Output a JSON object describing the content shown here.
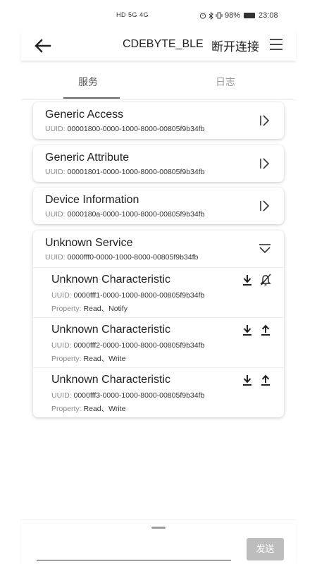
{
  "status_bar": {
    "signal_text": "HD 5G 4G",
    "alarm_icon": "alarm-icon",
    "bluetooth_icon": "bluetooth-icon",
    "vibrate_icon": "vibrate-icon",
    "battery": "98%",
    "time": "23:08"
  },
  "app_bar": {
    "title": "CDEBYTE_BLE",
    "disconnect_label": "断开连接",
    "back_icon": "arrow-left-icon",
    "menu_icon": "hamburger-menu-icon"
  },
  "tabs": [
    {
      "label": "服务",
      "active": true
    },
    {
      "label": "日志",
      "active": false
    }
  ],
  "uuid_label": "UUID: ",
  "property_label": "Property: ",
  "services": [
    {
      "name": "Generic Access",
      "uuid": "00001800-0000-1000-8000-00805f9b34fb",
      "expanded": false
    },
    {
      "name": "Generic Attribute",
      "uuid": "00001801-0000-1000-8000-00805f9b34fb",
      "expanded": false
    },
    {
      "name": "Device Information",
      "uuid": "0000180a-0000-1000-8000-00805f9b34fb",
      "expanded": false
    },
    {
      "name": "Unknown Service",
      "uuid": "0000fff0-0000-1000-8000-00805f9b34fb",
      "expanded": true,
      "characteristics": [
        {
          "name": "Unknown Characteristic",
          "uuid": "0000fff1-0000-1000-8000-00805f9b34fb",
          "property": "Read、Notify",
          "actions": [
            "download-icon",
            "notification-off-icon"
          ]
        },
        {
          "name": "Unknown Characteristic",
          "uuid": "0000fff2-0000-1000-8000-00805f9b34fb",
          "property": "Read、Write",
          "actions": [
            "download-icon",
            "upload-icon"
          ]
        },
        {
          "name": "Unknown Characteristic",
          "uuid": "0000fff3-0000-1000-8000-00805f9b34fb",
          "property": "Read、Write",
          "actions": [
            "download-icon",
            "upload-icon"
          ]
        }
      ]
    }
  ],
  "send_panel": {
    "input_value": "",
    "send_label": "发送"
  }
}
